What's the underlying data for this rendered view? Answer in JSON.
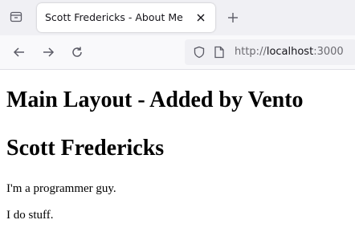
{
  "browser": {
    "tab": {
      "title": "Scott Fredericks - About Me"
    },
    "url": {
      "scheme": "http://",
      "host": "localhost",
      "port": ":3000"
    },
    "icons": {
      "tab_list": "tab-list-icon",
      "close": "close-icon",
      "new_tab": "plus-icon",
      "back": "back-arrow-icon",
      "forward": "forward-arrow-icon",
      "reload": "reload-icon",
      "tracking_protection": "shield-icon",
      "page_info": "page-icon"
    }
  },
  "page": {
    "layout_heading": "Main Layout - Added by Vento",
    "name_heading": "Scott Fredericks",
    "paragraphs": [
      "I'm a programmer guy.",
      "I do stuff."
    ]
  },
  "colors": {
    "tab_strip": "#f0f0f4",
    "toolbar": "#f9f9fb",
    "url_field": "#f0f0f4"
  }
}
